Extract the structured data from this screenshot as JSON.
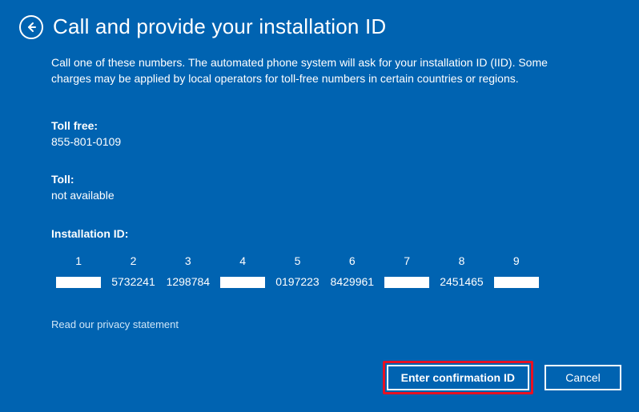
{
  "header": {
    "title": "Call and provide your installation ID"
  },
  "intro": "Call one of these numbers. The automated phone system will ask for your installation ID (IID). Some charges may be applied by local operators for toll-free numbers in certain countries or regions.",
  "toll_free": {
    "label": "Toll free:",
    "value": "855-801-0109"
  },
  "toll": {
    "label": "Toll:",
    "value": "not available"
  },
  "iid": {
    "label": "Installation ID:",
    "columns": [
      "1",
      "2",
      "3",
      "4",
      "5",
      "6",
      "7",
      "8",
      "9"
    ],
    "values": [
      "",
      "5732241",
      "1298784",
      "",
      "0197223",
      "8429961",
      "",
      "2451465",
      ""
    ]
  },
  "privacy": "Read our privacy statement",
  "buttons": {
    "primary": "Enter confirmation ID",
    "cancel": "Cancel"
  },
  "colors": {
    "background": "#0063B1",
    "highlight": "#E81123",
    "text": "#ffffff"
  }
}
